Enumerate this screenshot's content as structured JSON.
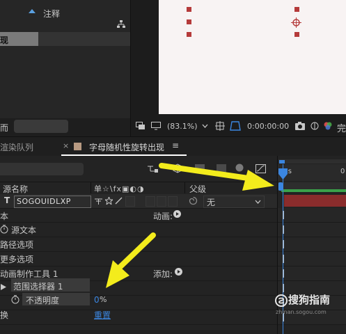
{
  "project_panel": {
    "column_label": "注释",
    "item_label": "现",
    "bottom_text": "而"
  },
  "viewer": {
    "zoom": "(83.1%)",
    "timecode": "0:00:00:00",
    "trailing_char": "完"
  },
  "tabs": {
    "render_queue": "渲染队列",
    "close": "×",
    "comp_name": "字母随机性旋转出现",
    "menu": "≡"
  },
  "ruler": {
    "start_label": "00s",
    "next_label": "0"
  },
  "columns": {
    "source_name": "源名称",
    "switches": "单☆\\fx▣◐◑",
    "parent": "父级"
  },
  "layer": {
    "type_letter": "T",
    "name": "SOGOUIDLXP",
    "parent_value": "无"
  },
  "rows": {
    "text": "本",
    "source_text": "源文本",
    "animate_label": "动画:",
    "path_options": "路径选项",
    "more_options": "更多选项",
    "animator": "动画制作工具 1",
    "add_label": "添加:",
    "range_selector": "范围选择器 1",
    "opacity": "不透明度",
    "opacity_value": "0",
    "opacity_unit": "%",
    "reset_left": "换",
    "reset": "重置"
  },
  "watermark": {
    "brand": "搜狗指南",
    "url": "zhinan.sogou.com"
  },
  "colors": {
    "accent_blue": "#3b86e0",
    "layer_bar_red": "#8a2c2c",
    "work_area_green": "#3aa14a",
    "annotation_yellow": "#f3ec1c"
  }
}
